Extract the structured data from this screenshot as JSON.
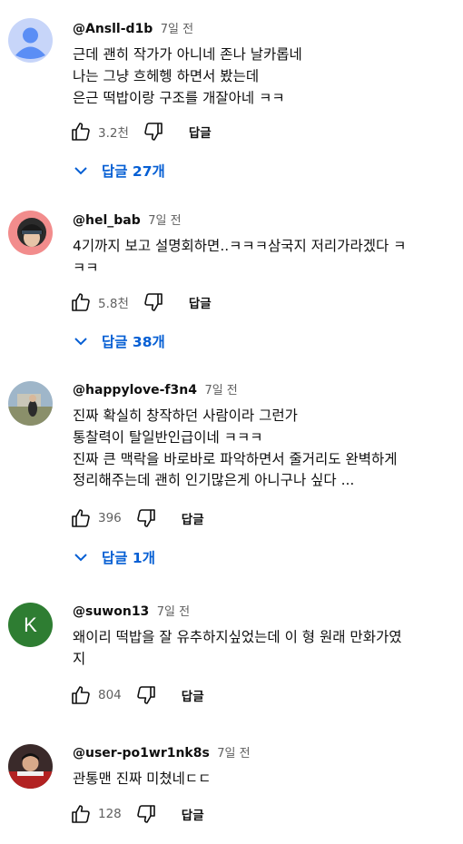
{
  "comments": [
    {
      "author": "@Ansll-d1b",
      "time": "7일 전",
      "text": "근데 괜히 작가가 아니네 존나 날카롭네\n나는 그냥 흐헤헹 하면서 봤는데\n은근 떡밥이랑 구조를 개잘아네 ㅋㅋ",
      "likes": "3.2천",
      "reply_label": "답글",
      "replies": "답글 27개"
    },
    {
      "author": "@hel_bab",
      "time": "7일 전",
      "text": "4기까지 보고 설명회하면..ㅋㅋㅋ삼국지 저리가라겠다 ㅋ\nㅋㅋ",
      "likes": "5.8천",
      "reply_label": "답글",
      "replies": "답글 38개"
    },
    {
      "author": "@happylove-f3n4",
      "time": "7일 전",
      "text": "진짜 확실히 창작하던 사람이라 그런가\n통찰력이 탈일반인급이네 ㅋㅋㅋ\n진짜 큰 맥락을 바로바로 파악하면서 줄거리도 완벽하게\n정리해주는데 괜히 인기많은게 아니구나 싶다 ...",
      "likes": "396",
      "reply_label": "답글",
      "replies": "답글 1개"
    },
    {
      "author": "@suwon13",
      "time": "7일 전",
      "text": "왜이리 떡밥을 잘 유추하지싶었는데 이 형 원래 만화가였\n지",
      "likes": "804",
      "reply_label": "답글",
      "avatar_letter": "K"
    },
    {
      "author": "@user-po1wr1nk8s",
      "time": "7일 전",
      "text": "관통맨 진짜 미쳤네ㄷㄷ",
      "likes": "128",
      "reply_label": "답글"
    }
  ],
  "colors": {
    "link": "#065fd4",
    "muted": "#606060",
    "avatar_k": "#2e7d32",
    "avatar_default": "#5b8ef5"
  }
}
